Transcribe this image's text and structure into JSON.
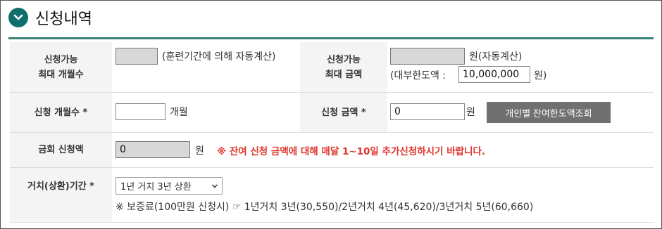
{
  "header": {
    "title": "신청내역"
  },
  "rows": {
    "r1": {
      "label_a1": "신청가능",
      "label_a2": "최대 개월수",
      "auto_months_note": "(훈련기간에 의해 자동계산)",
      "label_b1": "신청가능",
      "label_b2": "최대 금액",
      "auto_amount_note": "원(자동계산)",
      "limit_prefix": "(대부한도액 :",
      "limit_value": "10,000,000",
      "limit_suffix": "원)"
    },
    "r2": {
      "label_months": "신청 개월수 *",
      "months_unit": "개월",
      "label_amount": "신청 금액 *",
      "amount_value": "0",
      "amount_unit": "원",
      "lookup_button": "개인별 잔여한도액조회"
    },
    "r3": {
      "label": "금회 신청액",
      "value": "0",
      "unit": "원",
      "notice": "※ 잔여 신청 금액에 대해 매달 1~10일 추가신청하시기 바랍니다."
    },
    "r4": {
      "label": "거치(상환)기간 *",
      "selected": "1년 거치 3년 상환",
      "insurance_note": "※ 보증료(100만원 신청시) ☞ 1년거치 3년(30,550)/2년거치 4년(45,620)/3년거치 5년(60,660)"
    }
  }
}
